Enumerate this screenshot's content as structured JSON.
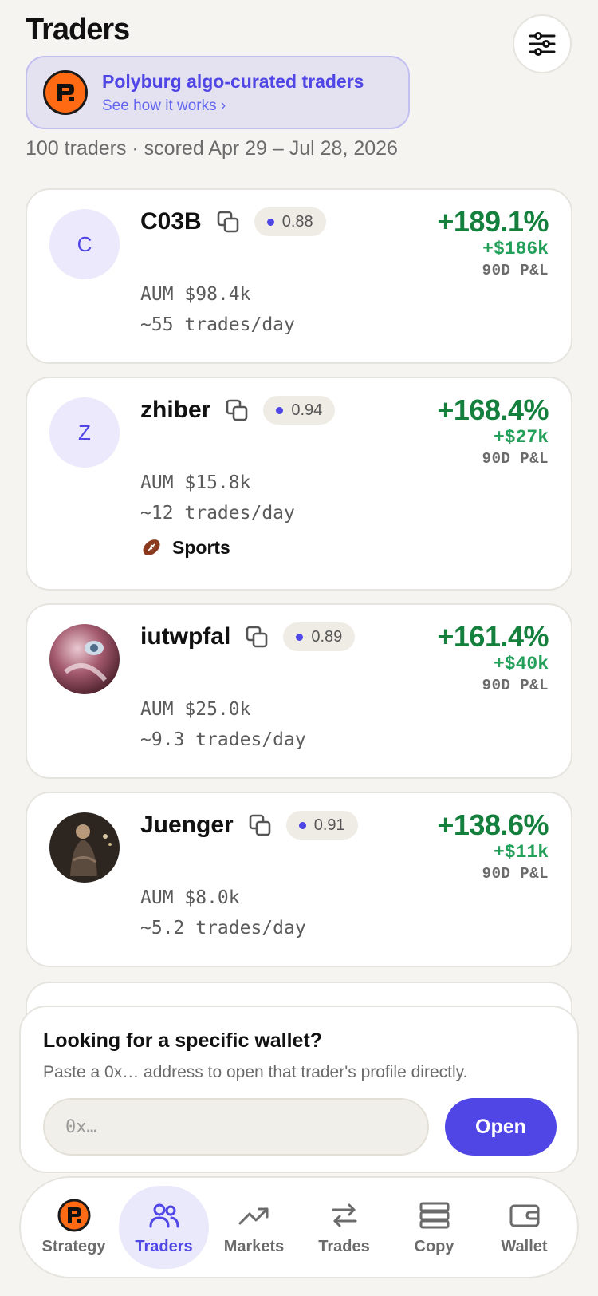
{
  "header": {
    "title": "Traders"
  },
  "curated": {
    "title": "Polyburg algo-curated traders",
    "link": "See how it works ›"
  },
  "summary": "100 traders · scored Apr 29 – Jul 28, 2026",
  "traders": [
    {
      "initial": "C",
      "name": "C03B",
      "score": "0.88",
      "pnl_pct": "+189.1%",
      "pnl_usd": "+$186k",
      "pnl_label": "90D P&L",
      "aum": "AUM $98.4k",
      "trades": "~55 trades/day"
    },
    {
      "initial": "Z",
      "name": "zhiber",
      "score": "0.94",
      "pnl_pct": "+168.4%",
      "pnl_usd": "+$27k",
      "pnl_label": "90D P&L",
      "aum": "AUM $15.8k",
      "trades": "~12 trades/day",
      "tag": "Sports"
    },
    {
      "name": "iutwpfal",
      "score": "0.89",
      "pnl_pct": "+161.4%",
      "pnl_usd": "+$40k",
      "pnl_label": "90D P&L",
      "aum": "AUM $25.0k",
      "trades": "~9.3 trades/day"
    },
    {
      "name": "Juenger",
      "score": "0.91",
      "pnl_pct": "+138.6%",
      "pnl_usd": "+$11k",
      "pnl_label": "90D P&L",
      "aum": "AUM $8.0k",
      "trades": "~5.2 trades/day"
    }
  ],
  "wallet": {
    "title": "Looking for a specific wallet?",
    "description": "Paste a 0x… address to open that trader's profile directly.",
    "placeholder": "0x…",
    "button": "Open"
  },
  "nav": {
    "items": [
      {
        "label": "Strategy"
      },
      {
        "label": "Traders"
      },
      {
        "label": "Markets"
      },
      {
        "label": "Trades"
      },
      {
        "label": "Copy"
      },
      {
        "label": "Wallet"
      }
    ],
    "active": "Traders"
  },
  "colors": {
    "accent": "#4f46e5",
    "gain": "#15803d",
    "brand_orange": "#ff6a13"
  }
}
